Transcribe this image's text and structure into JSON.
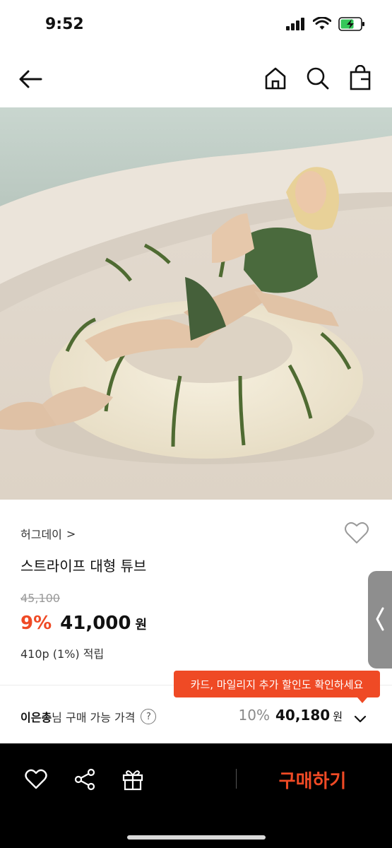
{
  "status_bar": {
    "time": "9:52"
  },
  "nav": {
    "icons": [
      "back-arrow-icon",
      "home-icon",
      "search-icon",
      "shopping-bag-icon"
    ]
  },
  "gallery": {
    "image_count": 2,
    "current_index": 1
  },
  "product": {
    "brand": "허그데이",
    "brand_chevron": ">",
    "title": "스트라이프 대형 튜브",
    "original_price": "45,100",
    "discount": "9%",
    "sale_price": "41,000",
    "currency": "원",
    "points": "410p (1%) 적립"
  },
  "tooltip": {
    "text": "카드, 마일리지 추가 할인도 확인하세요"
  },
  "member_price": {
    "name": "이은총",
    "label": "님 구매 가능 가격",
    "help": "?",
    "discount": "10%",
    "amount": "40,180",
    "currency": "원"
  },
  "bottom_bar": {
    "buy_label": "구매하기"
  },
  "colors": {
    "accent": "#ef4a25",
    "bottom_bar": "#000000",
    "stripe": "#4f6b32"
  }
}
